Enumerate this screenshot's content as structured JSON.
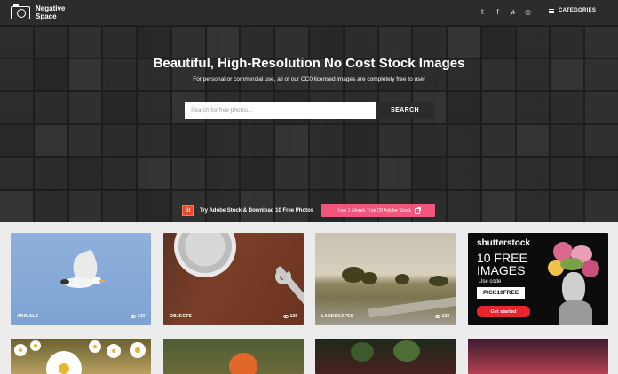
{
  "header": {
    "brand_line1": "Negative",
    "brand_line2": "Space",
    "social_icons": [
      "twitter-icon",
      "facebook-icon",
      "pinterest-icon",
      "instagram-icon"
    ],
    "social_glyphs": [
      "𝕥",
      "f",
      "𝓹",
      "◎"
    ],
    "categories_label": "CATEGORIES"
  },
  "hero": {
    "headline": "Beautiful, High-Resolution No Cost Stock Images",
    "subline": "For personal or commercial use, all of our CC0 licensed images are completely free to use!",
    "search_placeholder": "Search for free photos...",
    "search_button": "SEARCH"
  },
  "promo": {
    "badge": "St",
    "text": "Try Adobe Stock & Download 10 Free Photos",
    "button": "Free 1 Month Trial Of Adobe Stock"
  },
  "cards": [
    {
      "label": "ANIMALS",
      "views": "142"
    },
    {
      "label": "OBJECTS",
      "views": "136"
    },
    {
      "label": "LANDSCAPES",
      "views": "132"
    }
  ],
  "ad": {
    "logo": "shutterstock",
    "headline_1": "10 FREE",
    "headline_2": "IMAGES",
    "code_label": "Use code",
    "code": "PICK10FREE",
    "cta": "Get started"
  },
  "colors": {
    "promo_button": "#f2557a",
    "adobe_badge": "#e8452c",
    "shutterstock_cta": "#e7262a",
    "search_button": "#2b2b2b"
  }
}
